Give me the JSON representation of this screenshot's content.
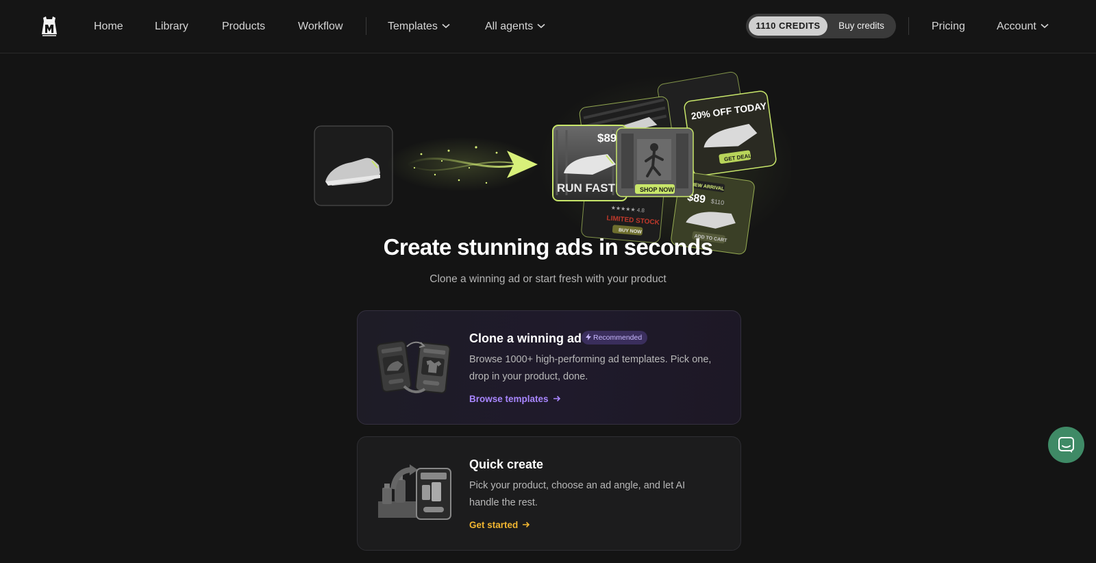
{
  "nav": {
    "items": [
      {
        "label": "Home"
      },
      {
        "label": "Library"
      },
      {
        "label": "Products"
      },
      {
        "label": "Workflow"
      },
      {
        "label": "Templates"
      },
      {
        "label": "All agents"
      }
    ],
    "credits_label": "1110 CREDITS",
    "buy_credits_label": "Buy credits",
    "pricing_label": "Pricing",
    "account_label": "Account"
  },
  "hero": {
    "title": "Create stunning ads in seconds",
    "subtitle": "Clone a winning ad or start fresh with your product",
    "ad_texts": {
      "price_1": "$89",
      "run_faster": "RUN FASTER",
      "shop_now": "SHOP NOW",
      "discount": "20% OFF TODAY",
      "get_deal": "GET DEAL",
      "rating": "★★★★★ 4.8",
      "limited_stock": "LIMITED STOCK",
      "buy_now": "BUY NOW",
      "new_arrival": "NEW ARRIVAL",
      "price_2": "$89",
      "price_old": "$110",
      "add_to_cart": "ADD TO CART"
    }
  },
  "cards": [
    {
      "title": "Clone a winning ad",
      "badge": "Recommended",
      "description": "Browse 1000+ high-performing ad templates. Pick one, drop in your product, done.",
      "link": "Browse templates"
    },
    {
      "title": "Quick create",
      "description": "Pick your product, choose an ad angle, and let AI handle the rest.",
      "link": "Get started"
    }
  ],
  "colors": {
    "background": "#141414",
    "accent_purple": "#a886ff",
    "accent_amber": "#f2b631",
    "chat_green": "#3f8a66",
    "glow_lime": "#c8e66a"
  },
  "icons": [
    "logo-icon",
    "chevron-down-icon",
    "lightning-icon",
    "arrow-right-icon",
    "chat-icon"
  ]
}
